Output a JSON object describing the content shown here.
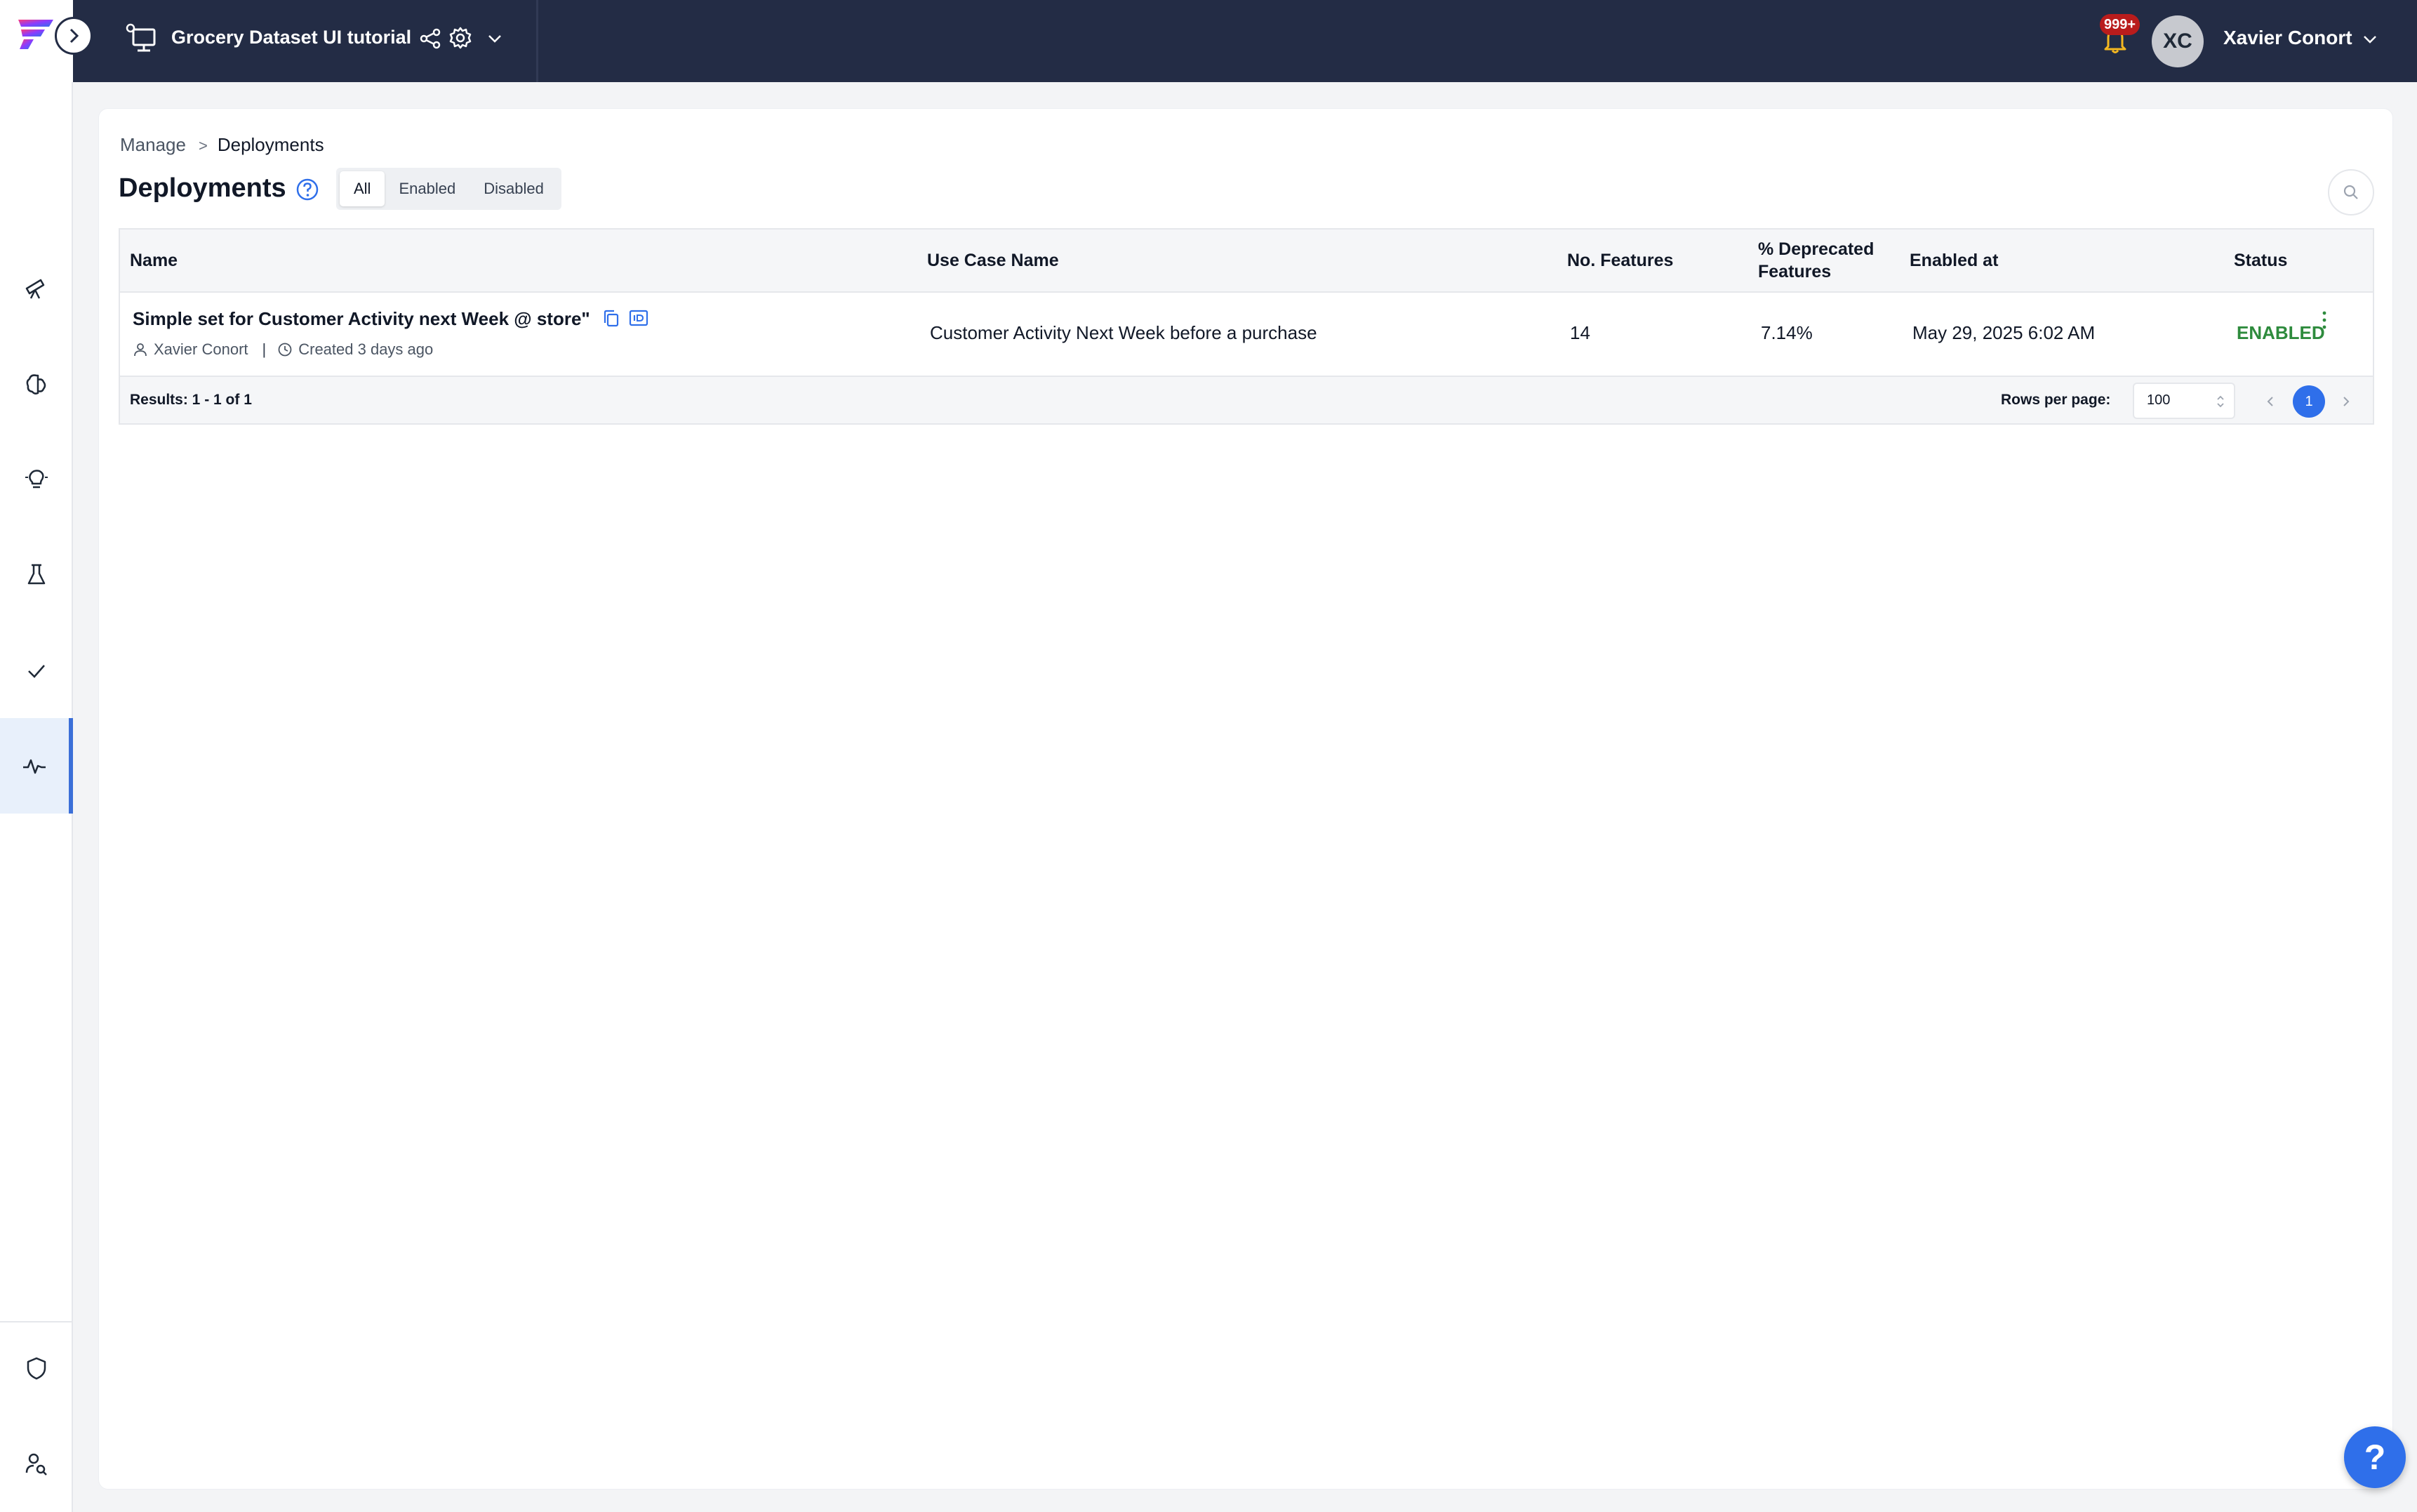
{
  "topbar": {
    "project_title": "Grocery Dataset UI tutorial",
    "notification_count": "999+",
    "user_initials": "XC",
    "user_name": "Xavier Conort"
  },
  "sidebar": {
    "items": [
      {
        "icon": "telescope-icon"
      },
      {
        "icon": "brain-icon"
      },
      {
        "icon": "lightbulb-icon"
      },
      {
        "icon": "flask-icon"
      },
      {
        "icon": "checkmark-icon"
      },
      {
        "icon": "activity-icon",
        "active": true
      }
    ],
    "bottom_items": [
      {
        "icon": "shield-icon"
      },
      {
        "icon": "user-search-icon"
      }
    ]
  },
  "breadcrumb": {
    "parent": "Manage",
    "separator": ">",
    "current": "Deployments"
  },
  "page": {
    "title": "Deployments",
    "filters": [
      "All",
      "Enabled",
      "Disabled"
    ],
    "selected_filter": "All"
  },
  "table": {
    "columns": [
      "Name",
      "Use Case Name",
      "No. Features",
      "% Deprecated Features",
      "Enabled at",
      "Status"
    ],
    "rows": [
      {
        "name": "Simple set for Customer Activity next Week @ store\"",
        "owner": "Xavier Conort",
        "created": "Created 3 days ago",
        "use_case": "Customer Activity Next Week before a purchase",
        "features": "14",
        "deprecated": "7.14%",
        "enabled_at": "May 29, 2025 6:02 AM",
        "status": "ENABLED"
      }
    ],
    "results": "Results: 1 - 1 of 1",
    "rows_per_page_label": "Rows per page:",
    "rows_per_page": "100",
    "current_page": "1"
  },
  "help_fab": "?",
  "colors": {
    "topbar": "#232c45",
    "accent": "#2f6fea",
    "status_enabled": "#2e8b3d",
    "badge": "#b91c1c"
  }
}
